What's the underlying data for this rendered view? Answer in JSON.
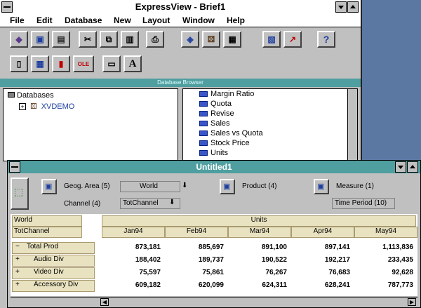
{
  "app": {
    "title": "ExpressView - Brief1",
    "menu": [
      "File",
      "Edit",
      "Database",
      "New",
      "Layout",
      "Window",
      "Help"
    ]
  },
  "toolbar1": [
    {
      "name": "open-database-icon",
      "glyph": "◆"
    },
    {
      "name": "open-brief-icon",
      "glyph": "▣"
    },
    {
      "name": "save-icon",
      "glyph": "▤"
    },
    {
      "name": "cut-icon",
      "glyph": "✂"
    },
    {
      "name": "copy-icon",
      "glyph": "⧉"
    },
    {
      "name": "paste-icon",
      "glyph": "▥"
    },
    {
      "name": "print-icon",
      "glyph": "⎙"
    },
    {
      "name": "database-browser-icon",
      "glyph": "◈"
    },
    {
      "name": "dice-icon",
      "glyph": "⚄"
    },
    {
      "name": "table-icon",
      "glyph": "▦"
    },
    {
      "name": "report-icon",
      "glyph": "▧"
    },
    {
      "name": "run-icon",
      "glyph": "↗"
    },
    {
      "name": "help-icon",
      "glyph": "?"
    }
  ],
  "toolbar2": [
    {
      "name": "new-page-icon",
      "glyph": "▯"
    },
    {
      "name": "new-table-icon",
      "glyph": "▦"
    },
    {
      "name": "new-chart-icon",
      "glyph": "▮"
    },
    {
      "name": "ole-icon",
      "glyph": "OLE"
    },
    {
      "name": "button-object-icon",
      "glyph": "▭"
    },
    {
      "name": "text-object-icon",
      "glyph": "A"
    }
  ],
  "browser": {
    "title": "Database Browser",
    "root": "Databases",
    "db": "XVDEMO",
    "measures": [
      "Margin Ratio",
      "Quota",
      "Revise",
      "Sales",
      "Sales vs Quota",
      "Stock Price",
      "Units"
    ]
  },
  "child": {
    "title": "Untitled1",
    "dims": {
      "geog_label": "Geog. Area (5)",
      "geog_value": "World",
      "channel_label": "Channel (4)",
      "channel_value": "TotChannel",
      "product_label": "Product (4)",
      "measure_label": "Measure (1)",
      "time_label": "Time Period (10)"
    },
    "page_labels": [
      "World",
      "TotChannel"
    ],
    "measure_header": "Units",
    "columns": [
      "Jan94",
      "Feb94",
      "Mar94",
      "Apr94",
      "May94"
    ],
    "rows": [
      {
        "prefix": "−",
        "label": "Total Prod",
        "values": [
          "873,181",
          "885,697",
          "891,100",
          "897,141",
          "1,113,836"
        ]
      },
      {
        "prefix": "+",
        "label": "Audio Div",
        "values": [
          "188,402",
          "189,737",
          "190,522",
          "192,217",
          "233,435"
        ]
      },
      {
        "prefix": "+",
        "label": "Video Div",
        "values": [
          "75,597",
          "75,861",
          "76,267",
          "76,683",
          "92,628"
        ]
      },
      {
        "prefix": "+",
        "label": "Accessory Div",
        "values": [
          "609,182",
          "620,099",
          "624,311",
          "628,241",
          "787,773"
        ]
      }
    ]
  }
}
